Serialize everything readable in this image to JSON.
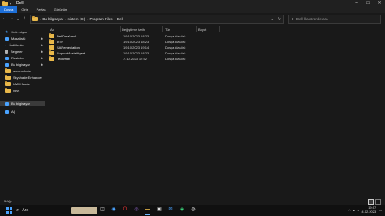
{
  "window": {
    "title": "Dell"
  },
  "ribbon": {
    "tabs": [
      "Dosya",
      "Giriş",
      "Paylaş",
      "Görünüm"
    ]
  },
  "address": {
    "crumbs": [
      "Bu bilgisayar",
      "sistem (C:)",
      "Program Files",
      "Dell"
    ]
  },
  "search": {
    "placeholder": "Dell klasöründe ara"
  },
  "sidebar": {
    "items": [
      {
        "label": "Hızlı erişim",
        "icon": "star-icon",
        "color": "#4aa3ff"
      },
      {
        "label": "Masaüstü",
        "icon": "desktop-icon",
        "color": "#4aa3ff",
        "pinned": true
      },
      {
        "label": "İndirilenler",
        "icon": "download-icon",
        "color": "#4aa3ff",
        "pinned": true
      },
      {
        "label": "Belgeler",
        "icon": "document-icon",
        "color": "#b0b0b0",
        "pinned": true
      },
      {
        "label": "Resimler",
        "icon": "picture-icon",
        "color": "#4aa3ff",
        "pinned": true
      },
      {
        "label": "Bu bilgisayar",
        "icon": "computer-icon",
        "color": "#4aa3ff",
        "pinned": true
      },
      {
        "label": "screenshots",
        "icon": "folder-icon",
        "color": "#e8b84a"
      },
      {
        "label": "Skyshade Enhancer",
        "icon": "folder-icon",
        "color": "#e8b84a"
      },
      {
        "label": "UMM Mods",
        "icon": "folder-icon",
        "color": "#e8b84a"
      },
      {
        "label": "vovs",
        "icon": "folder-icon",
        "color": "#e8b84a"
      },
      {
        "label": "Bu bilgisayar",
        "icon": "computer-icon",
        "color": "#4aa3ff",
        "selected": true
      },
      {
        "label": "Ağ",
        "icon": "network-icon",
        "color": "#4aa3ff"
      }
    ]
  },
  "table": {
    "headers": {
      "name": "Ad",
      "date": "Değiştirme tarihi",
      "type": "Tür",
      "size": "Boyut"
    },
    "rows": [
      {
        "name": "DellDataVault",
        "date": "19.10.2023 18:23",
        "type": "Dosya klasörü"
      },
      {
        "name": "DTP",
        "date": "19.10.2023 18:23",
        "type": "Dosya klasörü"
      },
      {
        "name": "SARemediation",
        "date": "19.10.2023 19:14",
        "type": "Dosya klasörü"
      },
      {
        "name": "SupportAssistAgent",
        "date": "19.10.2023 18:23",
        "type": "Dosya klasörü"
      },
      {
        "name": "TechHub",
        "date": "7.10.2023 17:52",
        "type": "Dosya klasörü"
      }
    ]
  },
  "status": {
    "count": "5 öğe"
  },
  "taskbar": {
    "search_label": "Ara",
    "time": "19:57",
    "date": "4.12.2023"
  },
  "colors": {
    "accent": "#1d6fd8",
    "folder": "#e8b84a",
    "background": "#191919"
  }
}
